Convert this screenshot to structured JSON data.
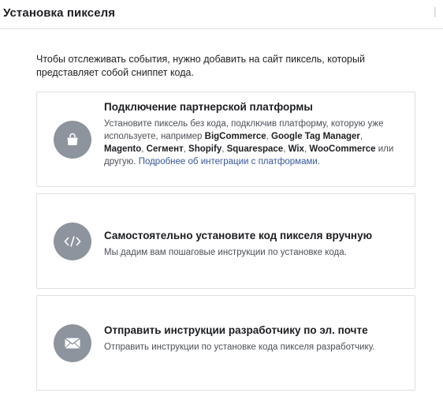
{
  "header": {
    "title": "Установка пикселя"
  },
  "intro": {
    "text": "Чтобы отслеживать события, нужно добавить на сайт пиксель, который представляет собой сниппет кода."
  },
  "options": [
    {
      "icon": "shopping-bag-icon",
      "title": "Подключение партнерской платформы",
      "desc_prefix": "Установите пиксель без кода, подключив платформу, которую уже используете, например ",
      "platforms": [
        "BigCommerce",
        "Google Tag Manager",
        "Magento",
        "Сегмент",
        "Shopify",
        "Squarespace",
        "Wix",
        "WooCommerce"
      ],
      "separator": ", ",
      "desc_suffix": " или другую. ",
      "link": "Подробнее об интеграции с платформами",
      "end": "."
    },
    {
      "icon": "code-icon",
      "title": "Самостоятельно установите код пикселя вручную",
      "desc": "Мы дадим вам пошаговые инструкции по установке кода."
    },
    {
      "icon": "envelope-icon",
      "title": "Отправить инструкции разработчику по эл. почте",
      "desc": "Отправить инструкции по установке кода пикселя разработчику."
    }
  ],
  "colors": {
    "icon_bg": "#8d949e",
    "link": "#365899",
    "border": "#dddfe2"
  }
}
